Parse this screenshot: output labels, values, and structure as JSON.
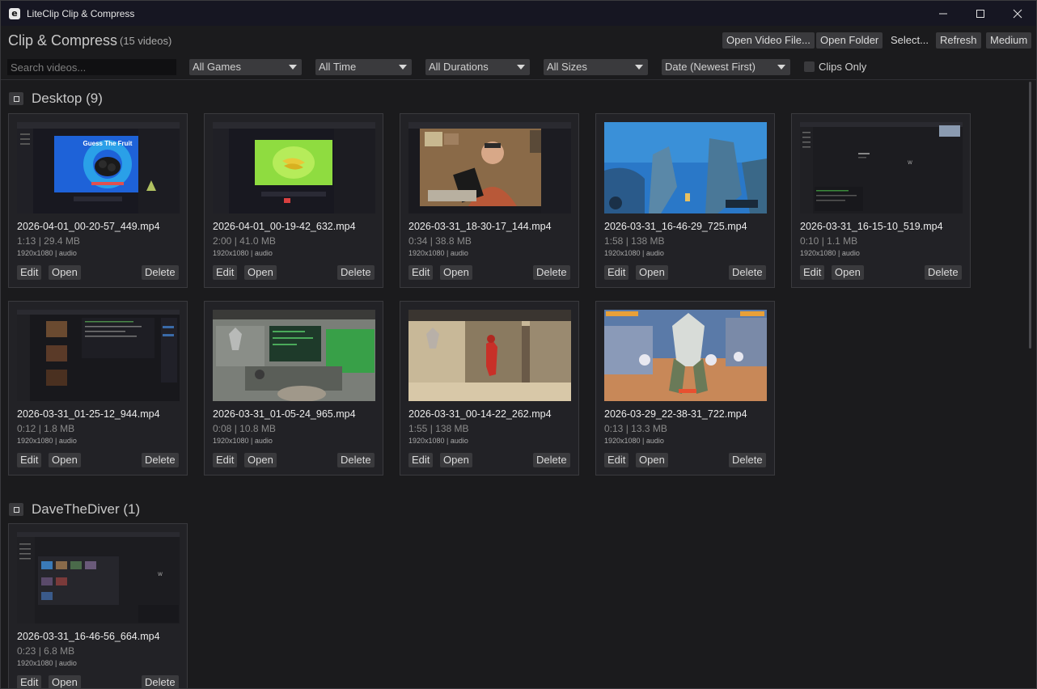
{
  "window": {
    "title": "LiteClip Clip & Compress",
    "icon_letter": "e"
  },
  "header": {
    "title": "Clip & Compress",
    "count": "(15 videos)",
    "open_file": "Open Video File...",
    "open_folder": "Open Folder",
    "select": "Select...",
    "refresh": "Refresh",
    "quality": "Medium"
  },
  "filters": {
    "search_placeholder": "Search videos...",
    "games": "All Games",
    "time": "All Time",
    "durations": "All Durations",
    "sizes": "All Sizes",
    "sort": "Date (Newest First)",
    "clips_only": "Clips Only"
  },
  "card_actions": {
    "edit": "Edit",
    "open": "Open",
    "delete": "Delete"
  },
  "groups": [
    {
      "title": "Desktop (9)",
      "videos": [
        {
          "name": "2026-04-01_00-20-57_449.mp4",
          "meta": "1:13 | 29.4 MB",
          "res": "1920x1080 | audio",
          "thumb_text": "Guess The  Fruit"
        },
        {
          "name": "2026-04-01_00-19-42_632.mp4",
          "meta": "2:00 | 41.0 MB",
          "res": "1920x1080 | audio"
        },
        {
          "name": "2026-03-31_18-30-17_144.mp4",
          "meta": "0:34 | 38.8 MB",
          "res": "1920x1080 | audio"
        },
        {
          "name": "2026-03-31_16-46-29_725.mp4",
          "meta": "1:58 | 138 MB",
          "res": "1920x1080 | audio"
        },
        {
          "name": "2026-03-31_16-15-10_519.mp4",
          "meta": "0:10 | 1.1 MB",
          "res": "1920x1080 | audio"
        },
        {
          "name": "2026-03-31_01-25-12_944.mp4",
          "meta": "0:12 | 1.8 MB",
          "res": "1920x1080 | audio"
        },
        {
          "name": "2026-03-31_01-05-24_965.mp4",
          "meta": "0:08 | 10.8 MB",
          "res": "1920x1080 | audio"
        },
        {
          "name": "2026-03-31_00-14-22_262.mp4",
          "meta": "1:55 | 138 MB",
          "res": "1920x1080 | audio"
        },
        {
          "name": "2026-03-29_22-38-31_722.mp4",
          "meta": "0:13 | 13.3 MB",
          "res": "1920x1080 | audio"
        }
      ]
    },
    {
      "title": "DaveTheDiver (1)",
      "videos": [
        {
          "name": "2026-03-31_16-46-56_664.mp4",
          "meta": "0:23 | 6.8 MB",
          "res": "1920x1080 | audio"
        }
      ]
    }
  ],
  "colors": {
    "accent_bg": "#3a3a3d",
    "window_bg": "#1b1b1d",
    "card_bg": "#222226",
    "titlebar_bg": "#161622"
  }
}
